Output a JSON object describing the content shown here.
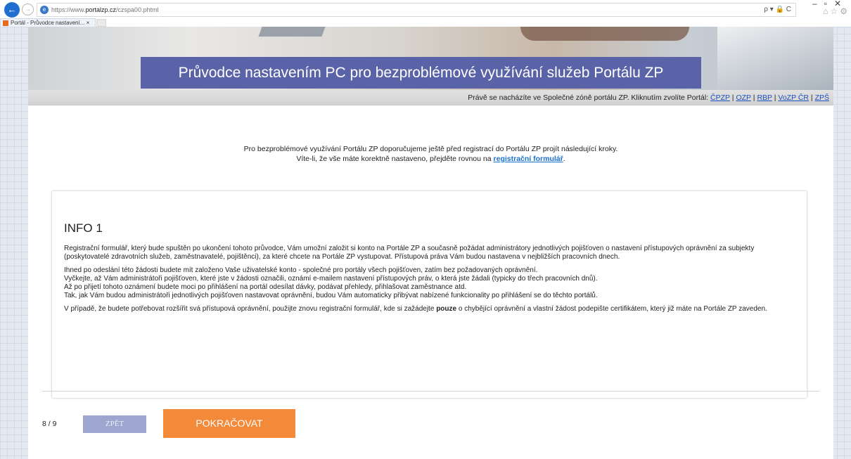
{
  "browser": {
    "url_host": "https://www.",
    "url_domain": "portalzp.cz",
    "url_path": "/czspa00.phtml",
    "tab_title": "Portál - Průvodce nastavení...",
    "tab_close": "×",
    "addr_tools": "ρ ▾ 🔒 C"
  },
  "banner": {
    "title": "Průvodce nastavením PC pro bezproblémové využívání služeb Portálu ZP"
  },
  "portal_strip": {
    "text": "Právě se nacházíte ve Společné zóně portálu ZP. Kliknutím zvolíte Portál:",
    "links": [
      "ČPZP",
      "OZP",
      "RBP",
      "VoZP ČR",
      "ZPŠ"
    ],
    "separator": "|"
  },
  "intro": {
    "line1": "Pro bezproblémové využívání Portálu ZP doporučujeme ještě před registrací do Portálu ZP projít následující kroky.",
    "line2_before": "Víte-li, že vše máte korektně nastaveno, přejděte rovnou na ",
    "line2_link": "registrační formulář",
    "line2_after": "."
  },
  "info": {
    "title": "INFO 1",
    "p1": "Registrační formulář, který bude spuštěn po ukončení tohoto průvodce, Vám umožní založit si konto na Portále ZP a současně požádat administrátory jednotlivých pojišťoven o nastavení přístupových oprávnění za subjekty (poskytovatelé zdravotních služeb, zaměstnavatelé, pojištěnci), za které chcete na Portále ZP vystupovat. Přístupová práva Vám budou nastavena v nejbližších pracovních dnech.",
    "p2_lines": [
      "Ihned po odeslání této žádosti budete mít založeno Vaše uživatelské konto - společné pro portály všech pojišťoven, zatím bez požadovaných oprávnění.",
      "Vyčkejte, až Vám administrátoři pojišťoven, které jste v žádosti označili, oznámí e-mailem nastavení přístupových práv, o která jste žádali (typicky do třech pracovních dnů).",
      "Až po přijetí tohoto oznámení budete moci po přihlášení na portál odesílat dávky, podávat přehledy, přihlašovat zaměstnance atd.",
      "Tak, jak Vám budou administrátoři jednotlivých pojišťoven nastavovat oprávnění, budou Vám automaticky přibývat nabízené funkcionality po přihlášení se do těchto portálů."
    ],
    "p3_before": "V případě, že budete potřebovat rozšířit svá přístupová oprávnění, použijte znovu registrační formulář, kde si zažádejte ",
    "p3_bold": "pouze",
    "p3_after": " o chybějící oprávnění a vlastní žádost podepište certifikátem, který již máte na Portále ZP zaveden."
  },
  "footer": {
    "step": "8 / 9",
    "back_label": "ZPĚT",
    "next_label": "POKRAČOVAT"
  },
  "colors": {
    "title_box": "#5b63a8",
    "next_button": "#f28a3a",
    "back_button": "#9ea6cf",
    "link": "#1a4fc0"
  }
}
